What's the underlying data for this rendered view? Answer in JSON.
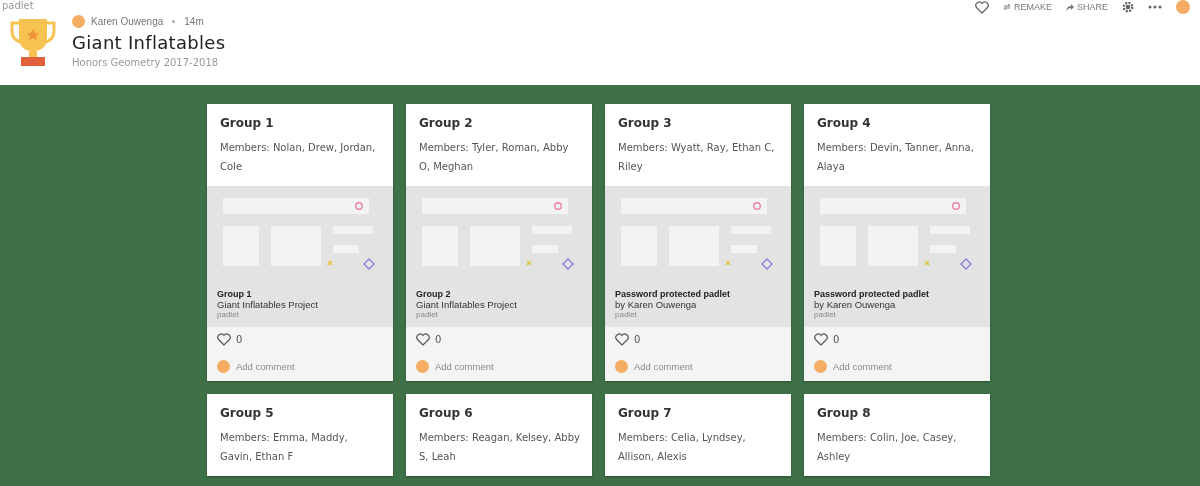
{
  "topbar": {
    "site": "padlet",
    "actions": [
      {
        "kind": "like"
      },
      {
        "kind": "remake",
        "label": "REMAKE"
      },
      {
        "kind": "share",
        "label": "SHARE"
      },
      {
        "kind": "settings"
      },
      {
        "kind": "more"
      },
      {
        "kind": "avatar"
      }
    ]
  },
  "header": {
    "author": "Karen Ouwenga",
    "time": "14m",
    "title": "Giant Inflatables",
    "subtitle": "Honors Geometry 2017-2018"
  },
  "cards": [
    {
      "title": "Group 1",
      "body": "Members: Nolan, Drew, Jordan, Cole",
      "attachment": {
        "title": "Group 1",
        "subtitle": "Giant Inflatables Project",
        "source": "padlet"
      },
      "likes": "0",
      "comment_placeholder": "Add comment"
    },
    {
      "title": "Group 2",
      "body": "Members: Tyler, Roman, Abby O, Meghan",
      "attachment": {
        "title": "Group 2",
        "subtitle": "Giant Inflatables Project",
        "source": "padlet"
      },
      "likes": "0",
      "comment_placeholder": "Add comment"
    },
    {
      "title": "Group 3",
      "body": "Members:  Wyatt, Ray, Ethan C, Riley",
      "attachment": {
        "title": "Password protected padlet",
        "subtitle": "by Karen Ouwenga",
        "source": "padlet"
      },
      "likes": "0",
      "comment_placeholder": "Add comment"
    },
    {
      "title": "Group 4",
      "body": "Members: Devin, Tanner, Anna, Alaya",
      "attachment": {
        "title": "Password protected padlet",
        "subtitle": "by Karen Ouwenga",
        "source": "padlet"
      },
      "likes": "0",
      "comment_placeholder": "Add comment"
    },
    {
      "title": "Group 5",
      "body": "Members: Emma, Maddy, Gavin, Ethan F"
    },
    {
      "title": "Group 6",
      "body": "Members: Reagan, Kelsey, Abby S, Leah"
    },
    {
      "title": "Group 7",
      "body": "Members: Celia, Lyndsey, Allison, Alexis"
    },
    {
      "title": "Group 8",
      "body": "Members: Colin, Joe, Casey, Ashley"
    }
  ]
}
